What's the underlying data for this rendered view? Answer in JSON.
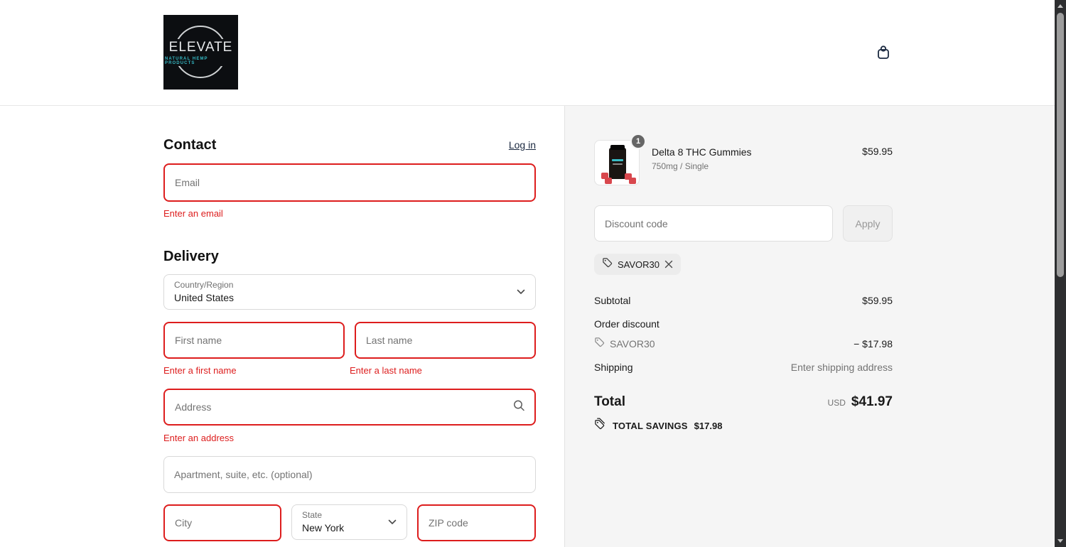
{
  "header": {
    "logo_line1": "ELEVATE",
    "logo_line2": "NATURAL HEMP PRODUCTS"
  },
  "contact": {
    "heading": "Contact",
    "login_label": "Log in",
    "email_placeholder": "Email",
    "email_error": "Enter an email"
  },
  "delivery": {
    "heading": "Delivery",
    "country_label": "Country/Region",
    "country_value": "United States",
    "first_name_placeholder": "First name",
    "first_name_error": "Enter a first name",
    "last_name_placeholder": "Last name",
    "last_name_error": "Enter a last name",
    "address_placeholder": "Address",
    "address_error": "Enter an address",
    "apartment_placeholder": "Apartment, suite, etc. (optional)",
    "city_placeholder": "City",
    "state_label": "State",
    "state_value": "New York",
    "zip_placeholder": "ZIP code"
  },
  "summary": {
    "item_name": "Delta 8 THC Gummies",
    "item_variant": "750mg / Single",
    "item_price": "$59.95",
    "item_quantity": "1",
    "discount_placeholder": "Discount code",
    "apply_label": "Apply",
    "applied_code": "SAVOR30",
    "subtotal_label": "Subtotal",
    "subtotal_value": "$59.95",
    "order_discount_label": "Order discount",
    "order_discount_code": "SAVOR30",
    "order_discount_value": "− $17.98",
    "shipping_label": "Shipping",
    "shipping_value": "Enter shipping address",
    "total_label": "Total",
    "total_currency": "USD",
    "total_value": "$41.97",
    "savings_label": "TOTAL SAVINGS",
    "savings_value": "$17.98"
  },
  "colors": {
    "error_red": "#dd1d1d",
    "brand_teal": "#35b7c2",
    "link_navy": "#1b2940",
    "panel_gray": "#f5f5f5"
  }
}
